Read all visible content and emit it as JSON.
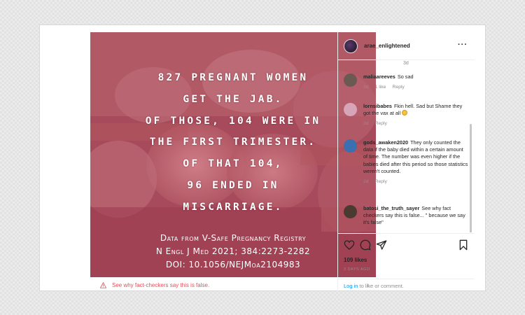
{
  "post": {
    "username": "arae_enlightened",
    "headline_lines": [
      "827 PREGNANT WOMEN",
      "GET THE JAB.",
      "OF THOSE, 104 WERE IN",
      "THE FIRST TRIMESTER.",
      "OF THAT 104,",
      "96 ENDED IN",
      "MISCARRIAGE."
    ],
    "source_lines": [
      "Data from V-Safe Pregnancy Registry",
      "N Engl J Med 2021; 384:2273-2282",
      "DOI: 10.1056/NEJMoa2104983"
    ],
    "factcheck_text": "See why fact-checkers say this is false.",
    "likes": "109 likes",
    "date": "3 DAYS AGO",
    "login_link": "Log in",
    "login_rest": " to like or comment."
  },
  "comments_stub": "3d",
  "comments": [
    {
      "user": "maliaareeves",
      "text": "So sad",
      "emoji": false,
      "time": "3d",
      "likes": "1 like",
      "reply": "Reply",
      "avatar_color": "#6b5a52"
    },
    {
      "user": "lornsibabes",
      "text": "Fkin hell. Sad but Shame they got the vax at all",
      "emoji": true,
      "time": "3d",
      "likes": "",
      "reply": "Reply",
      "avatar_color": "#d6a6b8"
    },
    {
      "user": "gods_awaken2020",
      "text": "They only counted the data if the baby died within a certain amount of time. The number was even higher if the babies died after this period so those statistics weren't counted.",
      "emoji": false,
      "time": "2d",
      "likes": "",
      "reply": "Reply",
      "avatar_color": "#3a6fb0"
    },
    {
      "user": "batosi_the_truth_sayer",
      "text": "See why fact checkers say this is false... \" because we say it's false\"",
      "emoji": false,
      "time": "",
      "likes": "",
      "reply": "",
      "avatar_color": "#4a3a30"
    }
  ],
  "icons": {
    "more": "more-horizontal-icon",
    "like": "heart-icon",
    "comment": "comment-icon",
    "share": "paper-plane-icon",
    "save": "bookmark-icon",
    "factcheck": "warning-icon",
    "chevron": "chevron-right-icon"
  },
  "colors": {
    "image_bg": "#a9475a",
    "factcheck_red": "#ed4956",
    "link_blue": "#0095f6"
  }
}
